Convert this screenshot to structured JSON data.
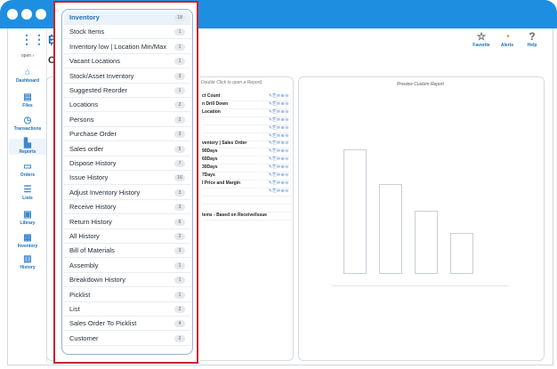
{
  "header": {
    "brand_partial": "B",
    "section_partial": "C",
    "actions": [
      {
        "label": "Favorite",
        "icon": "star-icon"
      },
      {
        "label": "Alerts",
        "icon": "bell-icon"
      },
      {
        "label": "Help",
        "icon": "question-icon"
      }
    ]
  },
  "sidebar": {
    "open_label": "open",
    "items": [
      {
        "label": "Dashboard",
        "icon": "home-icon"
      },
      {
        "label": "Files",
        "icon": "folder-icon"
      },
      {
        "label": "Transactions",
        "icon": "clock-icon"
      },
      {
        "label": "Reports",
        "icon": "chart-icon"
      },
      {
        "label": "Orders",
        "icon": "document-icon"
      },
      {
        "label": "Lists",
        "icon": "list-icon"
      },
      {
        "label": "Library",
        "icon": "image-icon"
      },
      {
        "label": "Inventory",
        "icon": "box-icon"
      },
      {
        "label": "History",
        "icon": "book-icon"
      }
    ]
  },
  "reports_panel": {
    "hint": "Double Click to open a Report)",
    "rows": [
      {
        "name": "ct Count"
      },
      {
        "name": "n Drill Down"
      },
      {
        "name": "Location"
      },
      {
        "name": ""
      },
      {
        "name": ""
      },
      {
        "name": ""
      },
      {
        "name": "ventory | Sales Order"
      },
      {
        "name": "90Days"
      },
      {
        "name": "60Days"
      },
      {
        "name": "30Days"
      },
      {
        "name": "7Days"
      },
      {
        "name": "l Price and Margin"
      },
      {
        "name": ""
      },
      {
        "name": ""
      },
      {
        "name": ""
      },
      {
        "name": "tems - Based on Receive/Issue"
      }
    ],
    "actions_glyphs": "✎⎘✉⊕⊖"
  },
  "preview": {
    "title": "Preview Custom Report",
    "bars": [
      1.0,
      0.72,
      0.5,
      0.32
    ]
  },
  "dropdown": {
    "items": [
      {
        "label": "Inventory",
        "count": "18",
        "selected": true
      },
      {
        "label": "Stock Items",
        "count": "1"
      },
      {
        "label": "Inventory low | Location Min/Max",
        "count": "1"
      },
      {
        "label": "Vacant Locations",
        "count": "1"
      },
      {
        "label": "Stock/Asset Inventory",
        "count": "3"
      },
      {
        "label": "Suggested Reorder",
        "count": "1"
      },
      {
        "label": "Locations",
        "count": "2"
      },
      {
        "label": "Persons",
        "count": "2"
      },
      {
        "label": "Purchase Order",
        "count": "3"
      },
      {
        "label": "Sales order",
        "count": "5"
      },
      {
        "label": "Dispose History",
        "count": "7"
      },
      {
        "label": "Issue History",
        "count": "16"
      },
      {
        "label": "Adjust Inventory History",
        "count": "3"
      },
      {
        "label": "Receive History",
        "count": "3"
      },
      {
        "label": "Return History",
        "count": "6"
      },
      {
        "label": "All History",
        "count": "2"
      },
      {
        "label": "Bill of Materials",
        "count": "3"
      },
      {
        "label": "Assembly",
        "count": "1"
      },
      {
        "label": "Breakdown History",
        "count": "1"
      },
      {
        "label": "Picklist",
        "count": "1"
      },
      {
        "label": "List",
        "count": "2"
      },
      {
        "label": "Sales Order To Picklist",
        "count": "4"
      },
      {
        "label": "Customer",
        "count": "2"
      }
    ]
  },
  "colors": {
    "titlebar": "#1e8fe0",
    "accent": "#1e6fb8",
    "highlight_border": "#c8232c"
  }
}
